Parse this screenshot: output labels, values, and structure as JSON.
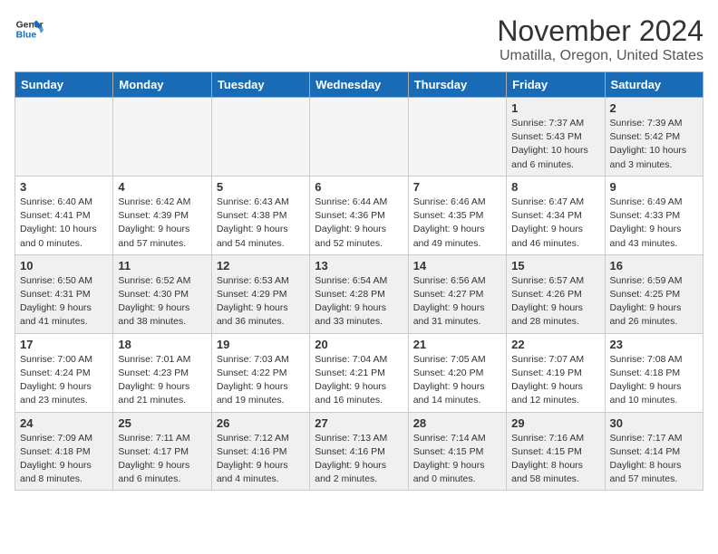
{
  "logo": {
    "text_general": "General",
    "text_blue": "Blue"
  },
  "header": {
    "month": "November 2024",
    "location": "Umatilla, Oregon, United States"
  },
  "days_of_week": [
    "Sunday",
    "Monday",
    "Tuesday",
    "Wednesday",
    "Thursday",
    "Friday",
    "Saturday"
  ],
  "weeks": [
    [
      {
        "day": "",
        "info": ""
      },
      {
        "day": "",
        "info": ""
      },
      {
        "day": "",
        "info": ""
      },
      {
        "day": "",
        "info": ""
      },
      {
        "day": "",
        "info": ""
      },
      {
        "day": "1",
        "info": "Sunrise: 7:37 AM\nSunset: 5:43 PM\nDaylight: 10 hours\nand 6 minutes."
      },
      {
        "day": "2",
        "info": "Sunrise: 7:39 AM\nSunset: 5:42 PM\nDaylight: 10 hours\nand 3 minutes."
      }
    ],
    [
      {
        "day": "3",
        "info": "Sunrise: 6:40 AM\nSunset: 4:41 PM\nDaylight: 10 hours\nand 0 minutes."
      },
      {
        "day": "4",
        "info": "Sunrise: 6:42 AM\nSunset: 4:39 PM\nDaylight: 9 hours\nand 57 minutes."
      },
      {
        "day": "5",
        "info": "Sunrise: 6:43 AM\nSunset: 4:38 PM\nDaylight: 9 hours\nand 54 minutes."
      },
      {
        "day": "6",
        "info": "Sunrise: 6:44 AM\nSunset: 4:36 PM\nDaylight: 9 hours\nand 52 minutes."
      },
      {
        "day": "7",
        "info": "Sunrise: 6:46 AM\nSunset: 4:35 PM\nDaylight: 9 hours\nand 49 minutes."
      },
      {
        "day": "8",
        "info": "Sunrise: 6:47 AM\nSunset: 4:34 PM\nDaylight: 9 hours\nand 46 minutes."
      },
      {
        "day": "9",
        "info": "Sunrise: 6:49 AM\nSunset: 4:33 PM\nDaylight: 9 hours\nand 43 minutes."
      }
    ],
    [
      {
        "day": "10",
        "info": "Sunrise: 6:50 AM\nSunset: 4:31 PM\nDaylight: 9 hours\nand 41 minutes."
      },
      {
        "day": "11",
        "info": "Sunrise: 6:52 AM\nSunset: 4:30 PM\nDaylight: 9 hours\nand 38 minutes."
      },
      {
        "day": "12",
        "info": "Sunrise: 6:53 AM\nSunset: 4:29 PM\nDaylight: 9 hours\nand 36 minutes."
      },
      {
        "day": "13",
        "info": "Sunrise: 6:54 AM\nSunset: 4:28 PM\nDaylight: 9 hours\nand 33 minutes."
      },
      {
        "day": "14",
        "info": "Sunrise: 6:56 AM\nSunset: 4:27 PM\nDaylight: 9 hours\nand 31 minutes."
      },
      {
        "day": "15",
        "info": "Sunrise: 6:57 AM\nSunset: 4:26 PM\nDaylight: 9 hours\nand 28 minutes."
      },
      {
        "day": "16",
        "info": "Sunrise: 6:59 AM\nSunset: 4:25 PM\nDaylight: 9 hours\nand 26 minutes."
      }
    ],
    [
      {
        "day": "17",
        "info": "Sunrise: 7:00 AM\nSunset: 4:24 PM\nDaylight: 9 hours\nand 23 minutes."
      },
      {
        "day": "18",
        "info": "Sunrise: 7:01 AM\nSunset: 4:23 PM\nDaylight: 9 hours\nand 21 minutes."
      },
      {
        "day": "19",
        "info": "Sunrise: 7:03 AM\nSunset: 4:22 PM\nDaylight: 9 hours\nand 19 minutes."
      },
      {
        "day": "20",
        "info": "Sunrise: 7:04 AM\nSunset: 4:21 PM\nDaylight: 9 hours\nand 16 minutes."
      },
      {
        "day": "21",
        "info": "Sunrise: 7:05 AM\nSunset: 4:20 PM\nDaylight: 9 hours\nand 14 minutes."
      },
      {
        "day": "22",
        "info": "Sunrise: 7:07 AM\nSunset: 4:19 PM\nDaylight: 9 hours\nand 12 minutes."
      },
      {
        "day": "23",
        "info": "Sunrise: 7:08 AM\nSunset: 4:18 PM\nDaylight: 9 hours\nand 10 minutes."
      }
    ],
    [
      {
        "day": "24",
        "info": "Sunrise: 7:09 AM\nSunset: 4:18 PM\nDaylight: 9 hours\nand 8 minutes."
      },
      {
        "day": "25",
        "info": "Sunrise: 7:11 AM\nSunset: 4:17 PM\nDaylight: 9 hours\nand 6 minutes."
      },
      {
        "day": "26",
        "info": "Sunrise: 7:12 AM\nSunset: 4:16 PM\nDaylight: 9 hours\nand 4 minutes."
      },
      {
        "day": "27",
        "info": "Sunrise: 7:13 AM\nSunset: 4:16 PM\nDaylight: 9 hours\nand 2 minutes."
      },
      {
        "day": "28",
        "info": "Sunrise: 7:14 AM\nSunset: 4:15 PM\nDaylight: 9 hours\nand 0 minutes."
      },
      {
        "day": "29",
        "info": "Sunrise: 7:16 AM\nSunset: 4:15 PM\nDaylight: 8 hours\nand 58 minutes."
      },
      {
        "day": "30",
        "info": "Sunrise: 7:17 AM\nSunset: 4:14 PM\nDaylight: 8 hours\nand 57 minutes."
      }
    ]
  ]
}
